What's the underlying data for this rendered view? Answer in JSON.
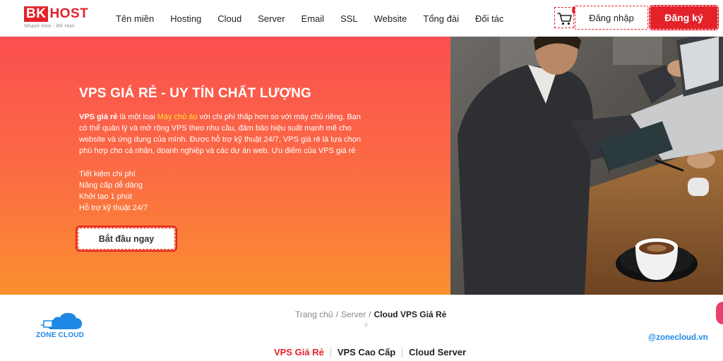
{
  "brand": {
    "logo_bk": "BK",
    "logo_host": "HOST",
    "tagline": "Nhanh Hơn - Rẻ Hơn",
    "accent_color": "#e3222a"
  },
  "nav": {
    "items": [
      "Tên miền",
      "Hosting",
      "Cloud",
      "Server",
      "Email",
      "SSL",
      "Website",
      "Tổng đài",
      "Đối tác"
    ]
  },
  "header": {
    "cart_icon": "cart-icon",
    "cart_count": "1",
    "login_label": "Đăng nhập",
    "register_label": "Đăng ký"
  },
  "hero": {
    "title": "VPS GIÁ RẺ - UY TÍN CHẤT LƯỢNG",
    "desc_bold": "VPS giá rẻ",
    "desc_pre": " là một loại ",
    "desc_link": "Máy chủ ảo",
    "desc_post": " với chi phí thấp hơn so với máy chủ riêng. Bạn có thể quản lý và mở rộng VPS theo nhu cầu, đảm bảo hiệu suất mạnh mẽ cho website và ứng dụng của mình. Được hỗ trợ kỹ thuật 24/7, VPS giá rẻ là lựa chọn phù hợp cho cá nhân, doanh nghiệp và các dự án web. Ưu điểm của VPS giá rẻ",
    "benefits": [
      "Tiết kiệm chi phí",
      "Nâng cấp dễ dàng",
      "Khởi tạo 1 phút",
      "Hỗ trợ kỹ thuật 24/7"
    ],
    "cta_label": "Bắt đầu ngay",
    "gradient_top": "#fb4f50",
    "gradient_bottom": "#fb8f30"
  },
  "breadcrumb": {
    "items": [
      "Trang chủ",
      "Server",
      "Cloud VPS Giá Rẻ"
    ],
    "separator": "/",
    "marker": "#"
  },
  "tabs": {
    "items": [
      "VPS Giá Rẻ",
      "VPS Cao Cấp",
      "Cloud Server"
    ],
    "active_index": 0
  },
  "watermark": {
    "logo_text": "ZONE CLOUD",
    "handle": "@zonecloud.vn",
    "color": "#1e88e5"
  }
}
